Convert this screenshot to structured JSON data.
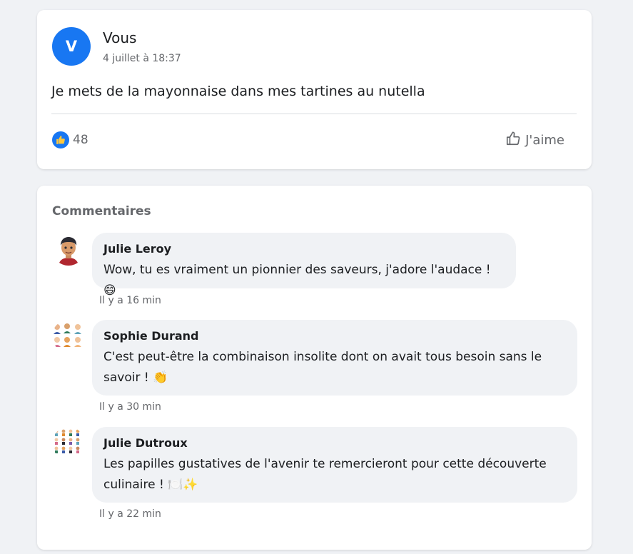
{
  "post": {
    "avatar_letter": "V",
    "author": "Vous",
    "timestamp": "4 juillet à 18:37",
    "text": "Je mets de la mayonnaise dans mes tartines au nutella",
    "reaction_count": "48",
    "like_label": "J'aime"
  },
  "comments_section": {
    "title": "Commentaires",
    "comments": [
      {
        "author": "Julie Leroy",
        "text": "Wow, tu es vraiment un pionnier des saveurs, j'adore l'audace ! 😄",
        "time": "Il y a 16 min"
      },
      {
        "author": "Sophie Durand",
        "text": "C'est peut-être la combinaison insolite dont on avait tous besoin sans le savoir ! 👏",
        "time": "Il y a 30 min"
      },
      {
        "author": "Julie Dutroux",
        "text": "Les papilles gustatives de l'avenir te remercieront pour cette découverte culinaire ! 🍽️✨",
        "time": "Il y a 22 min"
      }
    ]
  },
  "colors": {
    "accent": "#1877f2",
    "background": "#f0f2f5",
    "muted_text": "#65676b"
  },
  "icons": {
    "like_badge": "thumbs-up-icon",
    "like_button": "thumbs-up-outline-icon"
  }
}
